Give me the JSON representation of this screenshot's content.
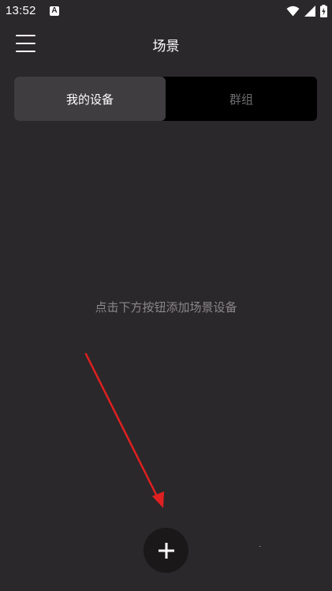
{
  "status_bar": {
    "time": "13:52",
    "notification_icon": "a-app-icon",
    "icons": [
      "wifi-icon",
      "signal-icon",
      "battery-icon"
    ]
  },
  "header": {
    "title": "场景",
    "menu_icon": "hamburger-menu-icon"
  },
  "tabs": [
    {
      "label": "我的设备",
      "active": true
    },
    {
      "label": "群组",
      "active": false
    }
  ],
  "empty_state": {
    "hint": "点击下方按钮添加场景设备"
  },
  "fab": {
    "icon": "plus-icon"
  },
  "colors": {
    "background": "#2b282b",
    "tab_active": "#403d40",
    "tab_inactive": "#000000",
    "annotation_arrow": "#e02020"
  }
}
